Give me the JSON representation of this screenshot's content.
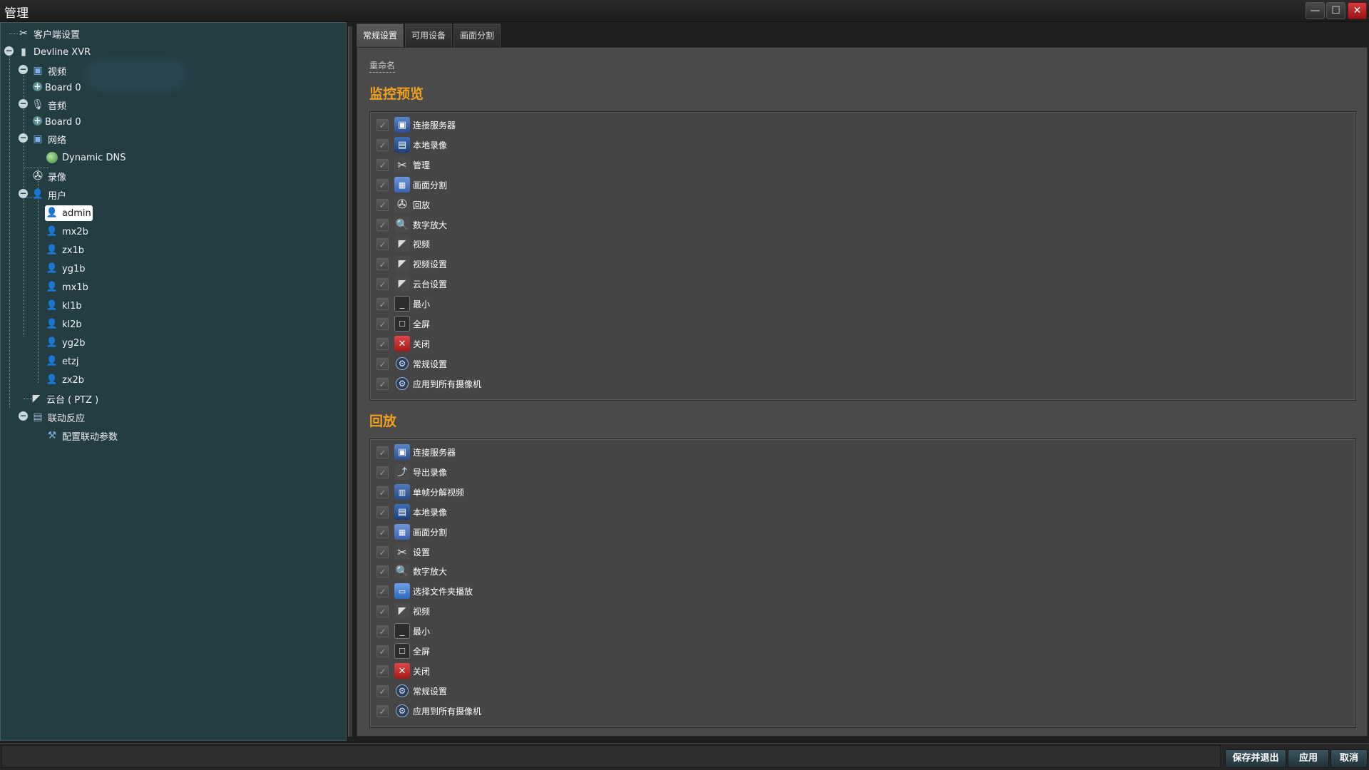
{
  "window": {
    "title": "管理",
    "min_symbol": "—",
    "max_symbol": "☐",
    "close_symbol": "✕"
  },
  "tree": {
    "client_settings": "客户端设置",
    "device": "Devline XVR",
    "video": "视频",
    "video_board": "Board 0",
    "audio": "音频",
    "audio_board": "Board 0",
    "network": "网络",
    "dynamic_dns": "Dynamic DNS",
    "recording": "录像",
    "users": "用户",
    "user_list": [
      "admin",
      "mx2b",
      "zx1b",
      "yg1b",
      "mx1b",
      "kl1b",
      "kl2b",
      "yg2b",
      "etzj",
      "zx2b"
    ],
    "ptz": "云台 ( PTZ )",
    "linkage": "联动反应",
    "linkage_params": "配置联动参数",
    "icons": {
      "tools": "tools-icon",
      "device": "server-icon",
      "monitor": "monitor-icon",
      "audio": "microphone-icon",
      "network": "network-icon",
      "globe": "globe-icon",
      "reel": "film-reel-icon",
      "user": "user-icon",
      "camera": "ptz-camera-icon",
      "linkage": "linkage-icon",
      "wrench": "linkage-config-icon"
    }
  },
  "tabs": [
    "常规设置",
    "可用设备",
    "画面分割"
  ],
  "rename_label": "重命名",
  "sections": [
    {
      "title": "监控预览",
      "items": [
        {
          "label": "连接服务器",
          "icon": "monitor-icon",
          "glyph": "▣"
        },
        {
          "label": "本地录像",
          "icon": "floppy-icon",
          "glyph": "▤"
        },
        {
          "label": "管理",
          "icon": "tools-icon",
          "glyph": "✂"
        },
        {
          "label": "画面分割",
          "icon": "grid-icon",
          "glyph": "▦"
        },
        {
          "label": "回放",
          "icon": "film-reel-icon",
          "glyph": "✇"
        },
        {
          "label": "数字放大",
          "icon": "zoom-icon",
          "glyph": "🔍"
        },
        {
          "label": "视频",
          "icon": "camera-icon",
          "glyph": "◤"
        },
        {
          "label": "视频设置",
          "icon": "camera-settings-icon",
          "glyph": "◤"
        },
        {
          "label": "云台设置",
          "icon": "ptz-settings-icon",
          "glyph": "◤"
        },
        {
          "label": "最小",
          "icon": "minimize-icon",
          "glyph": "_"
        },
        {
          "label": "全屏",
          "icon": "fullscreen-icon",
          "glyph": "☐"
        },
        {
          "label": "关闭",
          "icon": "close-icon",
          "glyph": "✕"
        },
        {
          "label": "常规设置",
          "icon": "general-settings-icon",
          "glyph": "⚙"
        },
        {
          "label": "应用到所有摄像机",
          "icon": "apply-all-icon",
          "glyph": "⚙"
        }
      ]
    },
    {
      "title": "回放",
      "items": [
        {
          "label": "连接服务器",
          "icon": "monitor-icon",
          "glyph": "▣"
        },
        {
          "label": "导出录像",
          "icon": "export-icon",
          "glyph": "⤴"
        },
        {
          "label": "单帧分解视频",
          "icon": "frames-icon",
          "glyph": "▥"
        },
        {
          "label": "本地录像",
          "icon": "floppy-icon",
          "glyph": "▤"
        },
        {
          "label": "画面分割",
          "icon": "grid-icon",
          "glyph": "▦"
        },
        {
          "label": "设置",
          "icon": "tools-icon",
          "glyph": "✂"
        },
        {
          "label": "数字放大",
          "icon": "zoom-icon",
          "glyph": "🔍"
        },
        {
          "label": "选择文件夹播放",
          "icon": "folder-icon",
          "glyph": "▭"
        },
        {
          "label": "视频",
          "icon": "camera-icon",
          "glyph": "◤"
        },
        {
          "label": "最小",
          "icon": "minimize-icon",
          "glyph": "_"
        },
        {
          "label": "全屏",
          "icon": "fullscreen-icon",
          "glyph": "☐"
        },
        {
          "label": "关闭",
          "icon": "close-icon",
          "glyph": "✕"
        },
        {
          "label": "常规设置",
          "icon": "general-settings-icon",
          "glyph": "⚙"
        },
        {
          "label": "应用到所有摄像机",
          "icon": "apply-all-icon",
          "glyph": "⚙"
        }
      ]
    }
  ],
  "buttons": {
    "save_exit": "保存并退出",
    "apply": "应用",
    "cancel": "取消"
  },
  "checkbox_mark": "✓"
}
